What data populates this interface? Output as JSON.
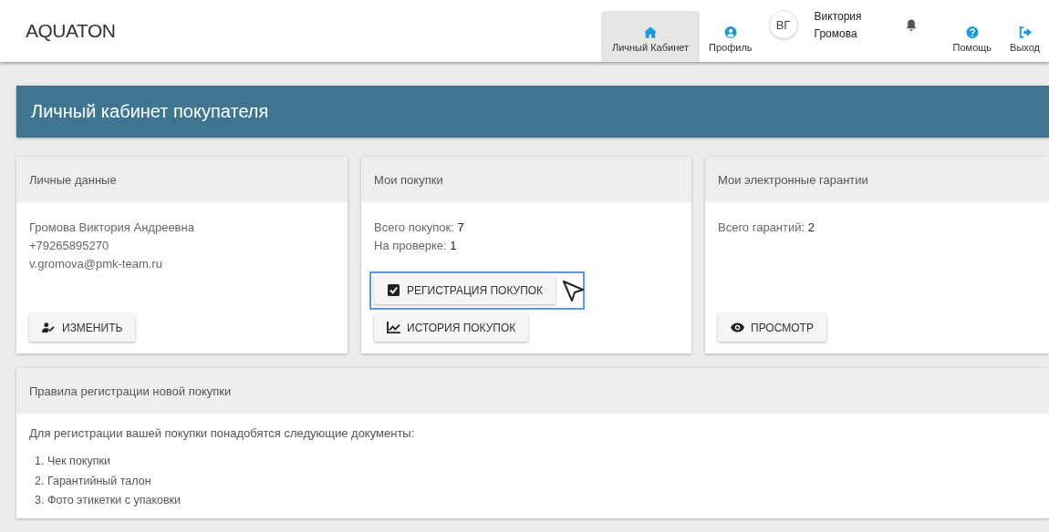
{
  "header": {
    "logo": "AQUATON",
    "nav": [
      {
        "label": "Личный Кабинет",
        "selected": true
      },
      {
        "label": "Профиль",
        "selected": false
      }
    ],
    "user": {
      "initials": "ВГ",
      "first_name": "Виктория",
      "last_name": "Громова"
    },
    "actions": [
      {
        "label": "Помощь"
      },
      {
        "label": "Выход"
      }
    ]
  },
  "banner": {
    "title": "Личный кабинет покупателя"
  },
  "cards": [
    {
      "title": "Личные данные",
      "lines": [
        {
          "label": "Громова Виктория Андреевна"
        },
        {
          "label": "+79265895270"
        },
        {
          "label": "v.gromova@pmk-team.ru"
        }
      ],
      "buttons": [
        {
          "label": "ИЗМЕНИТЬ",
          "highlighted": false
        }
      ]
    },
    {
      "title": "Мои покупки",
      "lines": [
        {
          "label": "Всего покупок:",
          "value": "7"
        },
        {
          "label": "На проверке:",
          "value": "1"
        }
      ],
      "buttons": [
        {
          "label": "РЕГИСТРАЦИЯ ПОКУПОК",
          "highlighted": true
        },
        {
          "label": "ИСТОРИЯ ПОКУПОК",
          "highlighted": false
        }
      ]
    },
    {
      "title": "Мои электронные гарантии",
      "lines": [
        {
          "label": "Всего гарантий:",
          "value": "2"
        }
      ],
      "buttons": [
        {
          "label": "ПРОСМОТР",
          "highlighted": false
        }
      ]
    }
  ],
  "rules": {
    "title": "Правила регистрации новой покупки",
    "intro": "Для регистрации вашей покупки понадобятся следующие документы:",
    "items": [
      "1. Чек покупки",
      "2. Гарантийный талон",
      "3. Фото этикетки с упаковки"
    ]
  }
}
